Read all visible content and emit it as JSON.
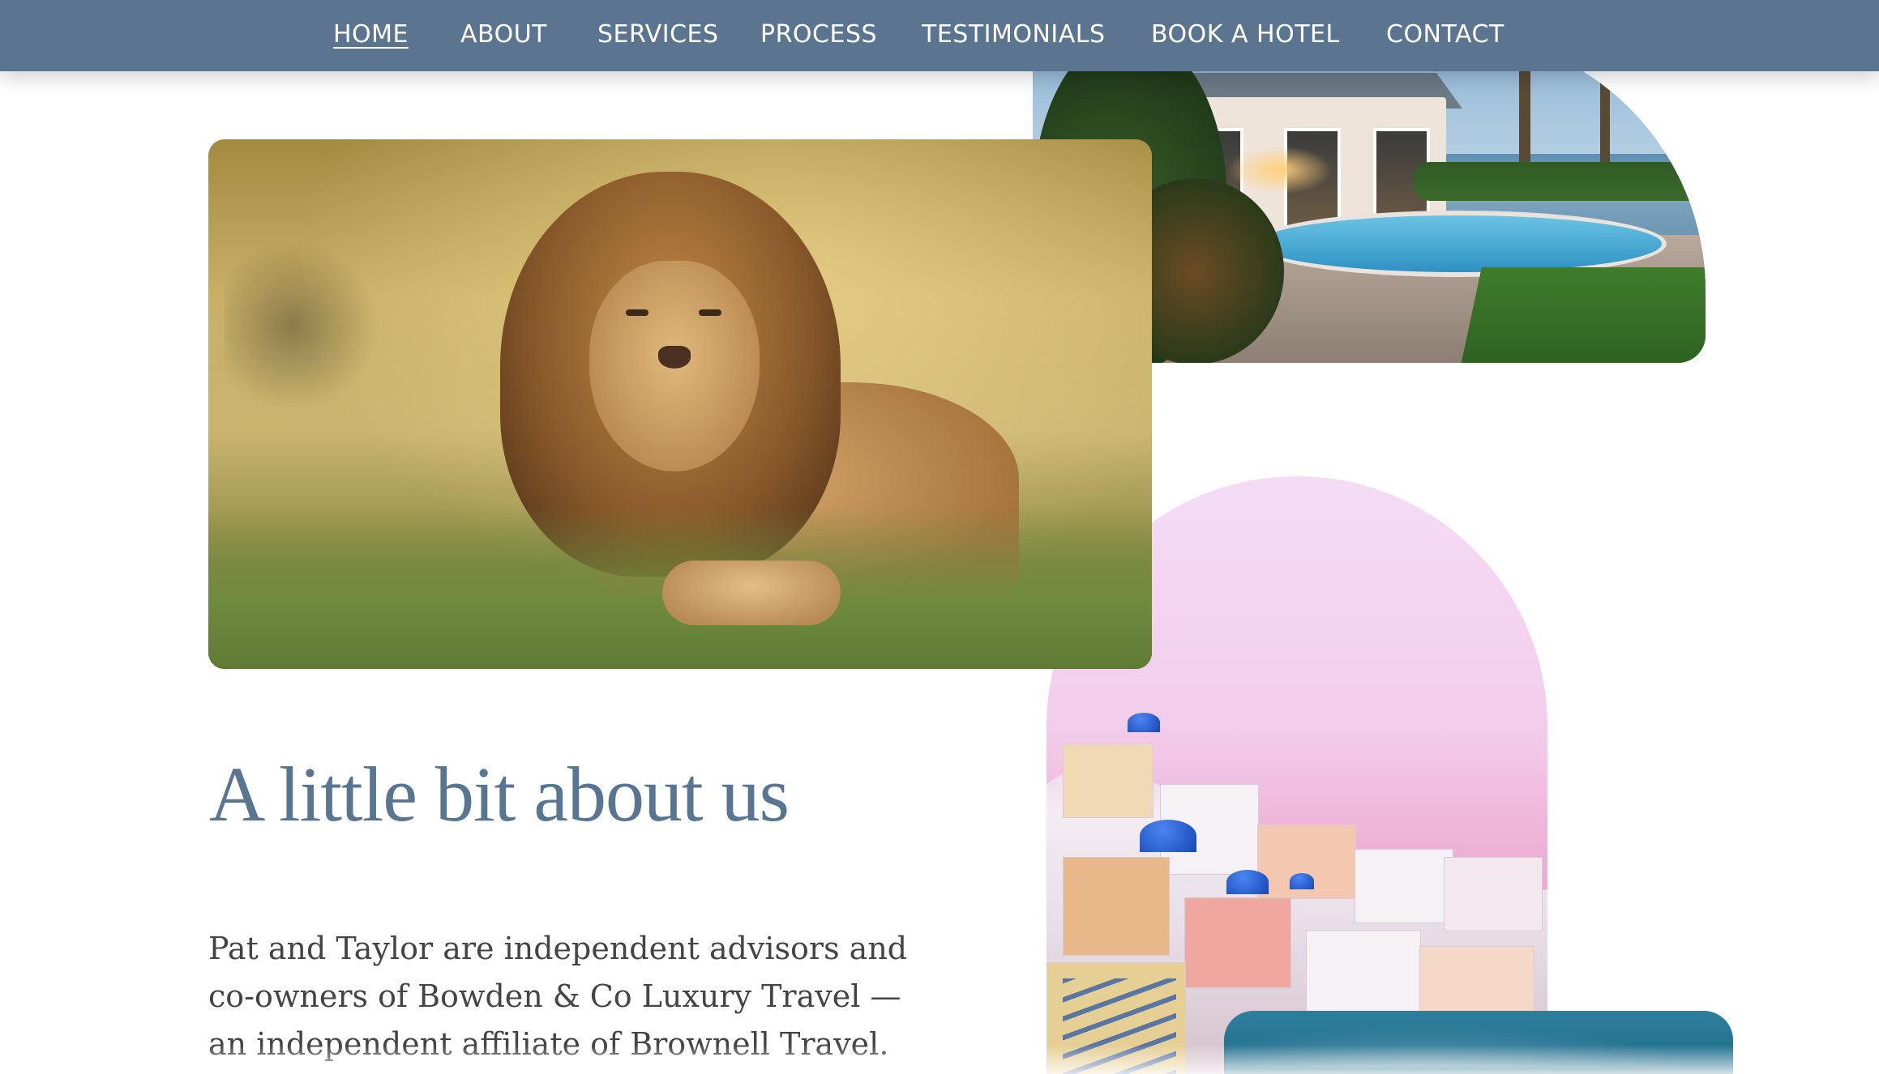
{
  "nav": {
    "items": [
      {
        "label": "HOME",
        "active": true
      },
      {
        "label": "ABOUT",
        "active": false
      },
      {
        "label": "SERVICES",
        "active": false
      },
      {
        "label": "PROCESS",
        "active": false
      },
      {
        "label": "TESTIMONIALS",
        "active": false
      },
      {
        "label": "BOOK A HOTEL",
        "active": false
      },
      {
        "label": "CONTACT",
        "active": false
      }
    ]
  },
  "about": {
    "title": "A little bit about us",
    "body": "Pat and Taylor are independent advisors and co-owners of Bowden & Co Luxury Travel — an independent affiliate of Brownell Travel. They"
  },
  "images": {
    "resort": "resort-pool-photo",
    "lion": "lion-in-grass-photo",
    "santorini": "santorini-village-photo",
    "teal": "ocean-photo"
  },
  "colors": {
    "nav_bg": "#5b7590",
    "nav_text": "#ffffff",
    "title": "#587691",
    "body_text": "#444444",
    "page_bg": "#ffffff"
  }
}
